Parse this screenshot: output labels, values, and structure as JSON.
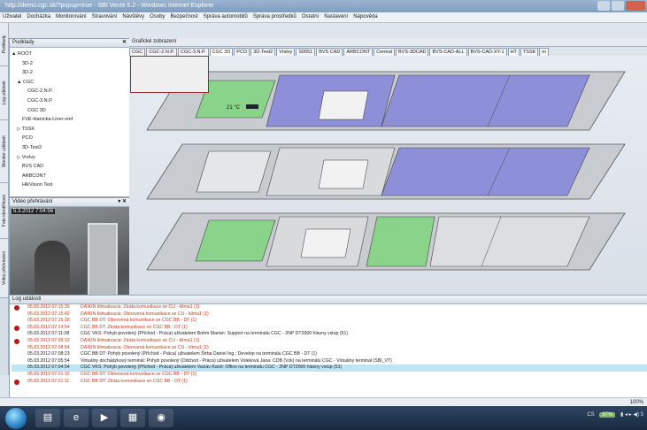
{
  "window": {
    "title": "http://demo.cgc.sk/?popup=true - SBI Verze 5.2 - Windows Internet Explorer"
  },
  "menu": [
    "Uživatel",
    "Docházka",
    "Monitorování",
    "Stravování",
    "Návštěvy",
    "Osoby",
    "Bezpečnost",
    "Správa automobilů",
    "Správa prostředků",
    "Ostatní",
    "Nastavení",
    "Nápověda"
  ],
  "left_tabs": [
    "Podklady",
    "Log události",
    "Monitor událostí",
    "Foto identifikace",
    "Video přehrávání"
  ],
  "tree_panel": {
    "title": "Podklady",
    "close": "✕",
    "items": [
      {
        "label": "▲ ROOT",
        "indent": 0
      },
      {
        "label": "3D-2",
        "indent": 2
      },
      {
        "label": "3D-2",
        "indent": 2
      },
      {
        "label": "▲ CGC",
        "indent": 1
      },
      {
        "label": "CGC-2.N.P.",
        "indent": 3
      },
      {
        "label": "CGC-3.N.P.",
        "indent": 3
      },
      {
        "label": "CGC 3D",
        "indent": 3
      },
      {
        "label": "FVE-Hanicka-Liner-vmf",
        "indent": 2
      },
      {
        "label": "▷ TSSK",
        "indent": 1
      },
      {
        "label": "PCO",
        "indent": 2
      },
      {
        "label": "3D-Test2",
        "indent": 2
      },
      {
        "label": "▷ Vrstvy",
        "indent": 1
      },
      {
        "label": "BVS CAD",
        "indent": 2
      },
      {
        "label": "ARBCONT",
        "indent": 2
      },
      {
        "label": "HikVision Test",
        "indent": 2
      }
    ]
  },
  "video_panel": {
    "title": "Video přehrávání",
    "close": "▾ ✕",
    "timestamp": "5.3.2012 7:04:56"
  },
  "graphic_panel": {
    "title": "Grafické zobrazení",
    "tabs": [
      "CGC",
      "CGC-2.N.P.",
      "CGC-3.N.P.",
      "CGC 3D",
      "PCO",
      "3D-Test2",
      "Vrstvy",
      "S0051",
      "BVS CAD",
      "ARBCONT",
      "Central",
      "BVS-3DCAD",
      "BVS-CAD-ALL",
      "BVS-CAD-XY-1",
      "HT",
      "TSSK",
      "m"
    ],
    "active_tab": 3,
    "temp_label": "21 °C"
  },
  "log": {
    "title": "Log události",
    "rows": [
      {
        "alert": true,
        "color": "red",
        "date": "05.03.2012 07:15:35",
        "text": "DAIKIN klimatizacia: Ztráta komunikace se CU - klima1 (1)"
      },
      {
        "alert": false,
        "color": "red",
        "date": "05.03.2012 07:15:42",
        "text": "DAIKIN klimatizacia: Obnovená komunikace se CU - klima1 (1)"
      },
      {
        "alert": false,
        "color": "red",
        "date": "05.03.2012 07:15:18",
        "text": "CGC BB DT: Obnovená komunikace se CGC BB - DT (1)"
      },
      {
        "alert": true,
        "color": "red",
        "date": "05.03.2012 07:14:54",
        "text": "CGC BB DT: Ztráta komunikace se CGC BB - DT (1)"
      },
      {
        "alert": false,
        "color": "blk",
        "date": "05.03.2012 07:11:08",
        "text": "CGC VKS: Pohyb povolený (Příchod - Práca) uživatelem Bohm Marian: Support na terminálu CGC - 2NP DT2000 hlavny vstup (51)"
      },
      {
        "alert": true,
        "color": "red",
        "date": "05.03.2012 07:09:12",
        "text": "DAIKIN klimatizacia: Ztráta komunikace se CU - klima1 (1)"
      },
      {
        "alert": false,
        "color": "red",
        "date": "05.03.2012 07:08:54",
        "text": "DAIKIN klimatizacia: Obnovená komunikace se CU - klima1 (1)"
      },
      {
        "alert": false,
        "color": "blk",
        "date": "05.03.2012 07:08:23",
        "text": "CGC BB DT: Pohyb povolený (Příchod - Práca) uživatelem Štrba Daniel Ing.: Develop na terminálu CGC BB - DT (1)"
      },
      {
        "alert": false,
        "color": "blk",
        "date": "05.03.2012 07:05:54",
        "text": "Virtuálny dochádzkový terminál: Pohyb povolený (Odchod - Práca) uživatelem Voleková Jana: CDB (Vzk) na terminálu CGC - Virtuálny terminal (SBI_VT)"
      },
      {
        "alert": false,
        "color": "sel",
        "date": "05.03.2012 07:04:54",
        "text": "CGC VKS: Pohyb povolený (Příchod - Práca) uživatelem Vaclav Karol: Office na terminálu CGC - 2NP DT2000 hlavny vstup (51)"
      },
      {
        "alert": false,
        "color": "red",
        "date": "05.03.2012 07:01:12",
        "text": "CGC BB DT: Obnovená komunikace se CGC BB - DT (1)"
      },
      {
        "alert": true,
        "color": "red",
        "date": "05.03.2012 07:01:11",
        "text": "CGC BB DT: Ztráta komunikace se CGC BB - DT (1)"
      }
    ]
  },
  "status": {
    "zoom": "100%"
  },
  "taskbar": {
    "tray": "CS",
    "battery": "97%",
    "time": "5"
  },
  "colors": {
    "room_blue": "#8e8fd9",
    "room_green": "#8ad38a",
    "floor_gray": "#c8ccd1",
    "alert_red": "#b31b1b",
    "log_red": "#cc3a1f",
    "selected_row": "#bfe4f3"
  }
}
